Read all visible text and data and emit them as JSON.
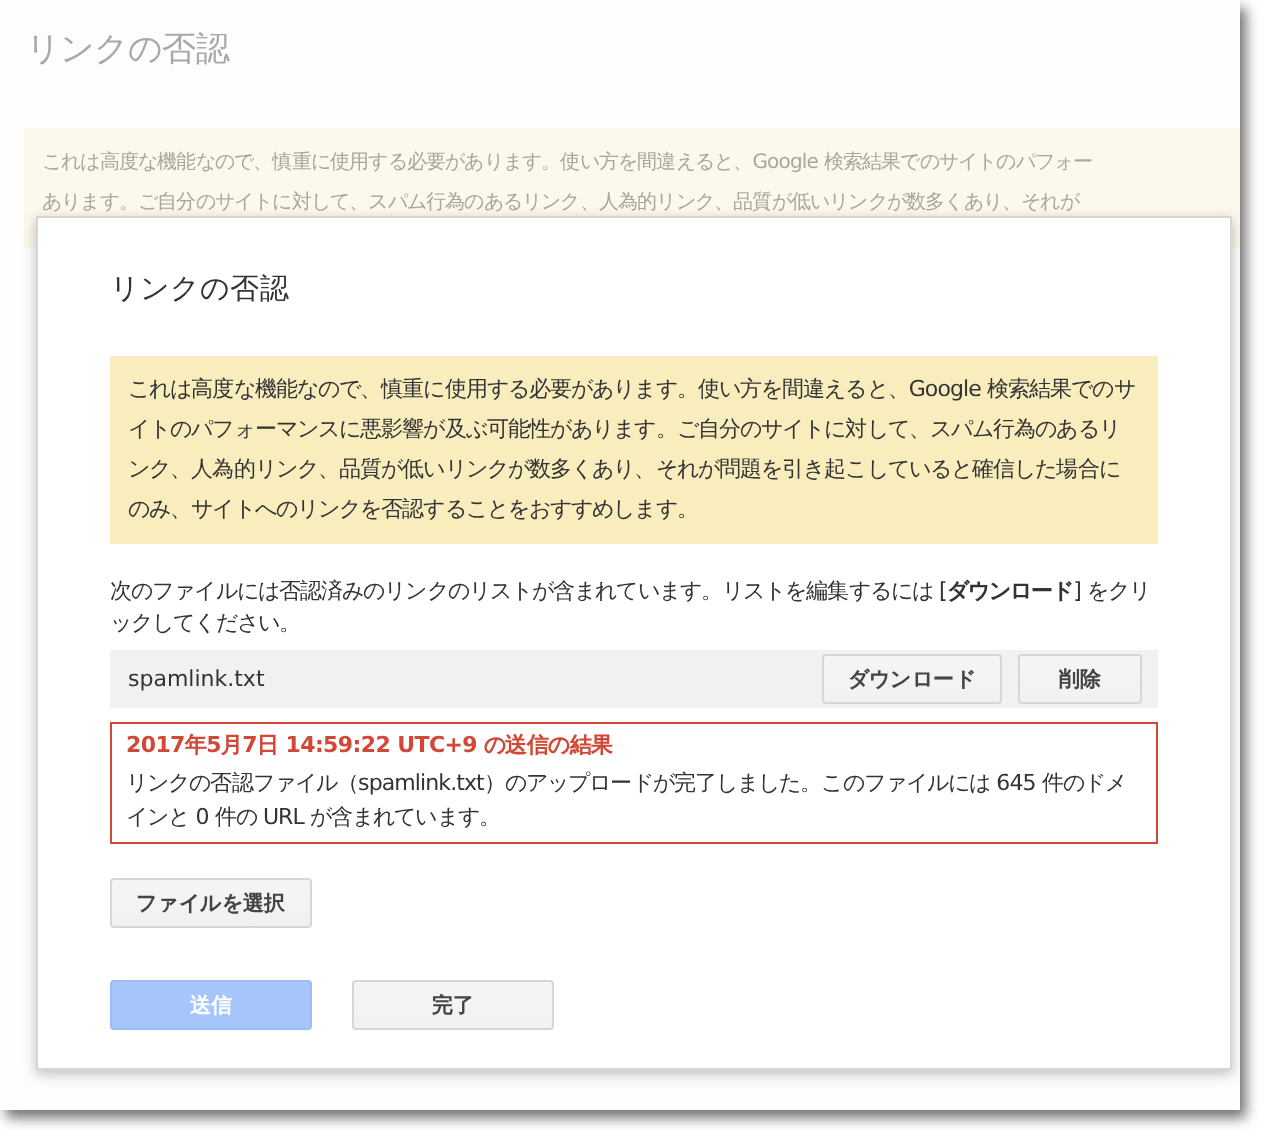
{
  "background_page": {
    "title": "リンクの否認",
    "warning_lines": [
      "これは高度な機能なので、慎重に使用する必要があります。使い方を間違えると、Google 検索結果でのサイトのパフォー",
      "あります。ご自分のサイトに対して、スパム行為のあるリンク、人為的リンク、品質が低いリンクが数多くあり、それが"
    ]
  },
  "dialog": {
    "title": "リンクの否認",
    "warning": "これは高度な機能なので、慎重に使用する必要があります。使い方を間違えると、Google 検索結果でのサイトのパフォーマンスに悪影響が及ぶ可能性があります。ご自分のサイトに対して、スパム行為のあるリンク、人為的リンク、品質が低いリンクが数多くあり、それが問題を引き起こしていると確信した場合にのみ、サイトへのリンクを否認することをおすすめします。",
    "instructions": "次のファイルには否認済みのリンクのリストが含まれています。リストを編集するには [**ダウンロード**] をクリックしてください。",
    "file": {
      "name": "spamlink.txt",
      "buttons": [
        {
          "label": "ダウンロード"
        },
        {
          "label": "削除"
        }
      ]
    },
    "result": {
      "heading": "2017年5月7日 14:59:22 UTC+9 の送信の結果",
      "message": "リンクの否認ファイル（spamlink.txt）のアップロードが完了しました。このファイルには 645 件のドメインと 0 件の URL が含まれています。"
    },
    "choose_file_button": "ファイルを選択",
    "actions": [
      {
        "label": "送信",
        "kind": "primary",
        "disabled": true
      },
      {
        "label": "完了",
        "kind": "secondary",
        "disabled": false
      }
    ]
  }
}
